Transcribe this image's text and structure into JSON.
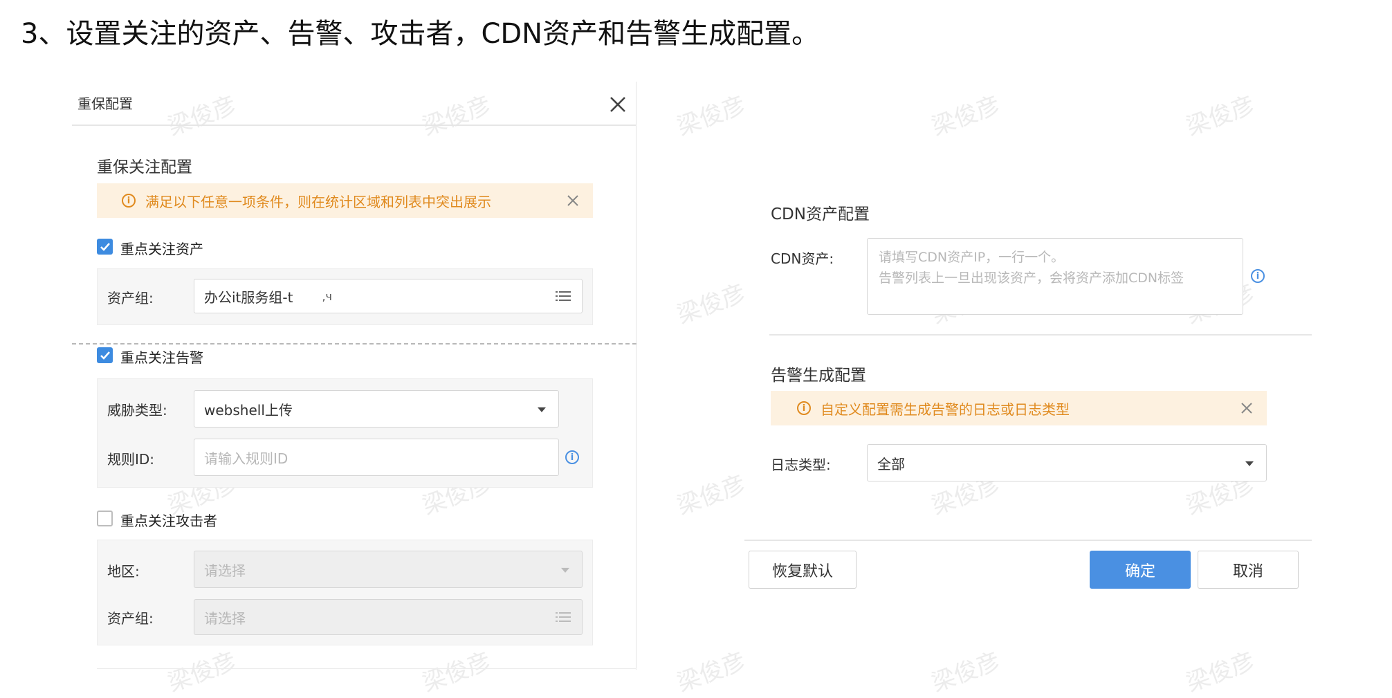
{
  "heading": "3、设置关注的资产、告警、攻击者，CDN资产和告警生成配置。",
  "watermark": "梁俊彦",
  "dialog": {
    "title": "重保配置",
    "section_title": "重保关注配置",
    "alert_text": "满足以下任意一项条件，则在统计区域和列表中突出展示",
    "asset_checkbox": {
      "label": "重点关注资产",
      "checked": true
    },
    "asset_group_label": "资产组:",
    "asset_group_value": "办公it服务组-t",
    "asset_group_extra": ",ч",
    "alert_checkbox": {
      "label": "重点关注告警",
      "checked": true
    },
    "threat_label": "威胁类型:",
    "threat_value": "webshell上传",
    "rule_label": "规则ID:",
    "rule_placeholder": "请输入规则ID",
    "attacker_checkbox": {
      "label": "重点关注攻击者",
      "checked": false
    },
    "region_label": "地区:",
    "region_placeholder": "请选择",
    "asset_group2_label": "资产组:",
    "asset_group2_placeholder": "请选择"
  },
  "cdn": {
    "section_title": "CDN资产配置",
    "label": "CDN资产:",
    "placeholder_line1": "请填写CDN资产IP，一行一个。",
    "placeholder_line2": "告警列表上一旦出现该资产，会将资产添加CDN标签"
  },
  "alert_gen": {
    "section_title": "告警生成配置",
    "alert_text": "自定义配置需生成告警的日志或日志类型",
    "log_type_label": "日志类型:",
    "log_type_value": "全部"
  },
  "buttons": {
    "restore": "恢复默认",
    "confirm": "确定",
    "cancel": "取消"
  },
  "colors": {
    "primary": "#4a90e2",
    "alert_bg": "#fdf1e0",
    "alert_text": "#e08a1e",
    "checkbox": "#3d8be0"
  }
}
